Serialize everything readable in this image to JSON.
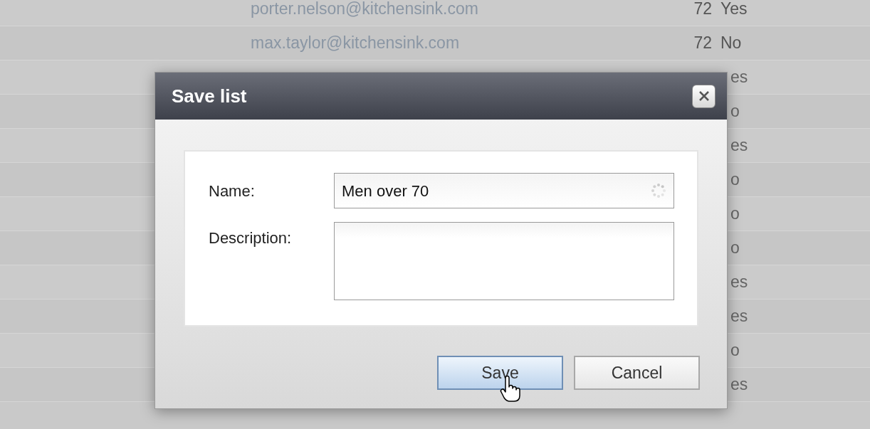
{
  "list": {
    "rows": [
      {
        "email": "porter.nelson@kitchensink.com",
        "column_2": "72",
        "column_3": "Yes"
      },
      {
        "email": "max.taylor@kitchensink.com",
        "column_2": "72",
        "column_3": "No"
      }
    ],
    "covered_rows": [
      {
        "column_3": "es"
      },
      {
        "column_3": "o"
      },
      {
        "column_3": "es"
      },
      {
        "column_3": "o"
      },
      {
        "column_3": "o"
      },
      {
        "column_3": "o"
      },
      {
        "column_3": "es"
      },
      {
        "column_3": "es"
      },
      {
        "column_3": "o"
      },
      {
        "column_3": "es"
      }
    ]
  },
  "dialog": {
    "title": "Save list",
    "fields": [
      {
        "kind": "text",
        "label": "Name:",
        "value": "Men over 70",
        "loading": true
      },
      {
        "kind": "textarea",
        "label": "Description:"
      }
    ],
    "buttons": [
      {
        "label": "Save",
        "focused": true
      },
      {
        "label": "Cancel",
        "focused": false
      }
    ]
  }
}
